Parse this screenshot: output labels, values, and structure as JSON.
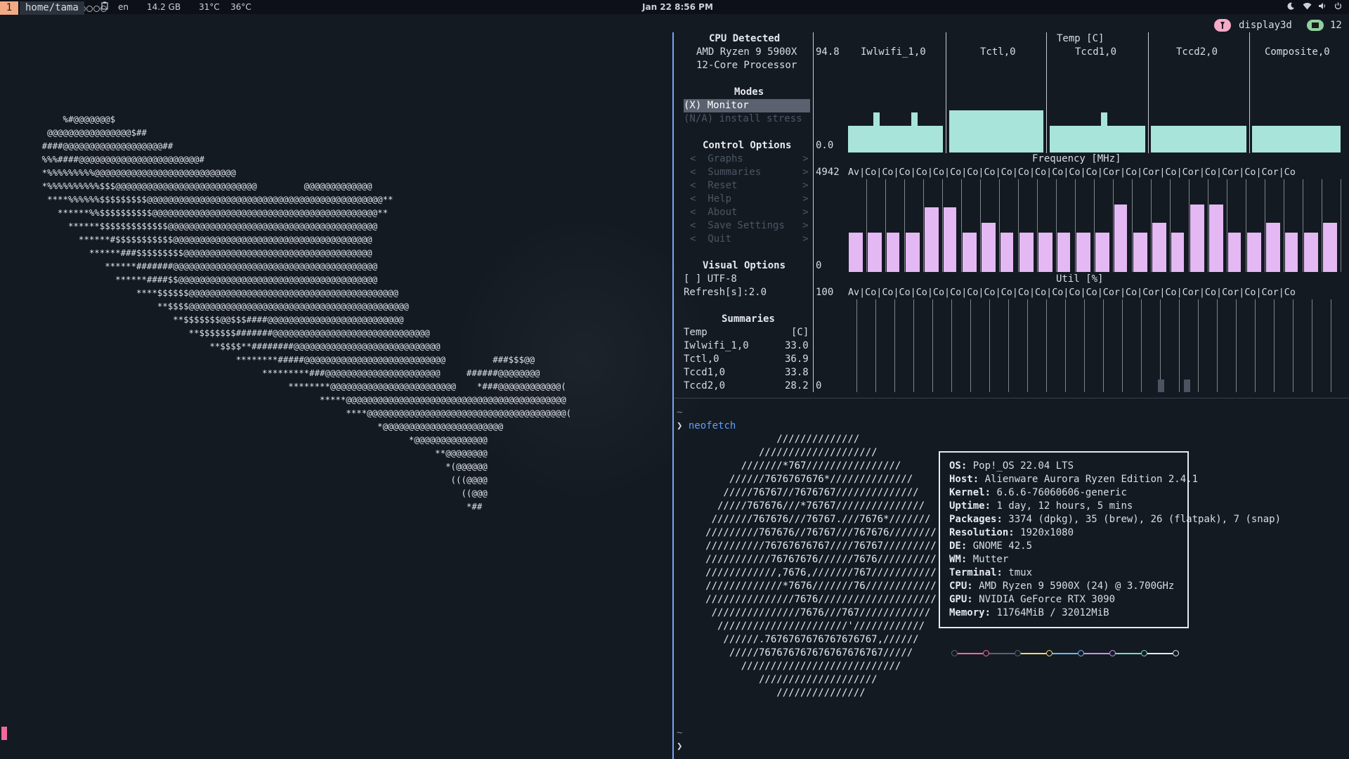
{
  "topbar": {
    "workspace_dots": [
      false,
      false,
      false,
      false,
      false,
      false,
      true,
      false,
      false,
      false,
      false,
      false
    ],
    "language": "en",
    "memory": "14.2 GB",
    "temp1": "31°C",
    "temp2": "36°C",
    "datetime": "Jan 22  8:56 PM",
    "icons": [
      "grid-icon",
      "clipboard-icon",
      "moon-icon",
      "wifi-icon",
      "volume-icon",
      "power-icon"
    ]
  },
  "tmux": {
    "window_index": "1",
    "path": "home/tama",
    "session_name": "display3d",
    "session_count": "12"
  },
  "ascii_art": "            %#@@@@@@@$\n         @@@@@@@@@@@@@@@@$##\n        ####@@@@@@@@@@@@@@@@@@@##\n        %%%####@@@@@@@@@@@@@@@@@@@@@@@#\n        *%%%%%%%%%@@@@@@@@@@@@@@@@@@@@@@@@@@@\n        *%%%%%%%%%%$$$@@@@@@@@@@@@@@@@@@@@@@@@@@@         @@@@@@@@@@@@@\n         ****%%%%%%$$$$$$$$$@@@@@@@@@@@@@@@@@@@@@@@@@@@@@@@@@@@@@@@@@@@@@**\n           ******%%$$$$$$$$$$@@@@@@@@@@@@@@@@@@@@@@@@@@@@@@@@@@@@@@@@@@@**\n             ******$$$$$$$$$$$$$@@@@@@@@@@@@@@@@@@@@@@@@@@@@@@@@@@@@@@@@\n               ******#$$$$$$$$$$$@@@@@@@@@@@@@@@@@@@@@@@@@@@@@@@@@@@@@@\n                 ******###$$$$$$$$$@@@@@@@@@@@@@@@@@@@@@@@@@@@@@@@@@@@@\n                    ******#######@@@@@@@@@@@@@@@@@@@@@@@@@@@@@@@@@@@@@@@\n                      ******####$$@@@@@@@@@@@@@@@@@@@@@@@@@@@@@@@@@@@@@@\n                          ****$$$$$$@@@@@@@@@@@@@@@@@@@@@@@@@@@@@@@@@@@@@@@@\n                              **$$$$@@@@@@@@@@@@@@@@@@@@@@@@@@@@@@@@@@@@@@@@@@\n                                 **$$$$$$$@@$$$####@@@@@@@@@@@@@@@@@@@@@@@@@@\n                                    **$$$$$$$#######@@@@@@@@@@@@@@@@@@@@@@@@@@@@@@\n                                        **$$$$**########@@@@@@@@@@@@@@@@@@@@@@@@@@@@\n                                             ********#####@@@@@@@@@@@@@@@@@@@@@@@@@@@         ###$$$@@\n                                                  *********###@@@@@@@@@@@@@@@@@@@@@@     ######@@@@@@@@\n                                                       ********@@@@@@@@@@@@@@@@@@@@@@@@    *###@@@@@@@@@@@@(\n                                                             *****@@@@@@@@@@@@@@@@@@@@@@@@@@@@@@@@@@@@@@@@@@\n                                                                  ****@@@@@@@@@@@@@@@@@@@@@@@@@@@@@@@@@@@@@@(\n                                                                        *@@@@@@@@@@@@@@@@@@@@@@@\n                                                                              *@@@@@@@@@@@@@@\n                                                                                   **@@@@@@@@\n                                                                                     *(@@@@@@\n                                                                                      (((@@@@\n                                                                                        ((@@@\n                                                                                         *##",
  "bpytop": {
    "cpu_title": "CPU Detected",
    "cpu_name_1": "AMD Ryzen 9 5900X",
    "cpu_name_2": "12-Core Processor",
    "modes_title": "Modes",
    "mode_monitor": "(X) Monitor",
    "mode_stress": "(N/A) install stress",
    "control_title": "Control Options",
    "control_items": [
      "<  Graphs          >",
      "<  Summaries       >",
      "<  Reset           >",
      "<  Help            >",
      "<  About           >",
      "<  Save Settings   >",
      "<  Quit            >"
    ],
    "visual_title": "Visual Options",
    "utf8": "[ ] UTF-8",
    "refresh": "Refresh[s]:2.0",
    "summaries_title": "Summaries",
    "summary_header_left": "Temp",
    "summary_header_right": "[C]",
    "summary_rows": [
      {
        "name": "Iwlwifi_1,0",
        "value": "33.0"
      },
      {
        "name": "Tctl,0",
        "value": "36.9"
      },
      {
        "name": "Tccd1,0",
        "value": "33.8"
      },
      {
        "name": "Tccd2,0",
        "value": "28.2"
      }
    ],
    "temp_title": "Temp [C]",
    "temp_max": "94.8",
    "temp_min": "0.0",
    "temp_sensors": [
      "Iwlwifi_1,0",
      "Tctl,0",
      "Tccd1,0",
      "Tccd2,0",
      "Composite,0"
    ],
    "freq_title": "Frequency [MHz]",
    "freq_max": "4942",
    "freq_min": "0",
    "util_title": "Util [%]",
    "util_max": "100",
    "util_min": "0",
    "core_labels": "Av|Co|Co|Co|Co|Co|Co|Co|Co|Co|Co|Co|Co|Co|Co|Cor|Co|Cor|Co|Cor|Co|Cor|Co|Cor|Co"
  },
  "terminal": {
    "tilde1": "~",
    "prompt_symbol": "❯",
    "command": "neofetch",
    "tilde2": "~",
    "prompt2": "❯"
  },
  "neofetch_logo": "                 //////////////\n              ////////////////////\n           ///////*767////////////////\n         //////7676767676*//////////////\n        /////76767//7676767//////////////\n       /////767676///*76767///////////////\n      ///////767676///76767.///7676*///////\n     /////////767676//76767///767676////////\n     //////////76767676767////76767/////////\n     ///////////76767676//////7676//////////\n     ////////////,7676,///////767///////////\n     /////////////*7676///////76////////////\n     ///////////////7676////////////////////\n      ///////////////7676///767////////////\n       //////////////////////'////////////\n        //////.7676767676767676767,//////\n         /////767676767676767676767/////\n           ///////////////////////////\n              ////////////////////\n                 ///////////////",
  "neofetch": [
    {
      "key": "OS",
      "value": "Pop!_OS 22.04 LTS"
    },
    {
      "key": "Host",
      "value": "Alienware Aurora Ryzen Edition 2.4.1"
    },
    {
      "key": "Kernel",
      "value": "6.6.6-76060606-generic"
    },
    {
      "key": "Uptime",
      "value": "1 day, 12 hours, 5 mins"
    },
    {
      "key": "Packages",
      "value": "3374 (dpkg), 35 (brew), 26 (flatpak), 7 (snap)"
    },
    {
      "key": "Resolution",
      "value": "1920x1080"
    },
    {
      "key": "DE",
      "value": "GNOME 42.5"
    },
    {
      "key": "WM",
      "value": "Mutter"
    },
    {
      "key": "Terminal",
      "value": "tmux"
    },
    {
      "key": "CPU",
      "value": "AMD Ryzen 9 5900X (24) @ 3.700GHz"
    },
    {
      "key": "GPU",
      "value": "NVIDIA GeForce RTX 3090"
    },
    {
      "key": "Memory",
      "value": "11764MiB / 32012MiB"
    }
  ],
  "palette_colors": [
    "#5c6370",
    "#f06a9a",
    "#5c6370",
    "#f4d77a",
    "#6cb6f0",
    "#c792ea",
    "#7fd6c8",
    "#e6e9ef"
  ],
  "colors": {
    "accent": "#7aa2f7",
    "temp_bars": "#a9e4da",
    "freq_bars": "#e3b8f3"
  }
}
